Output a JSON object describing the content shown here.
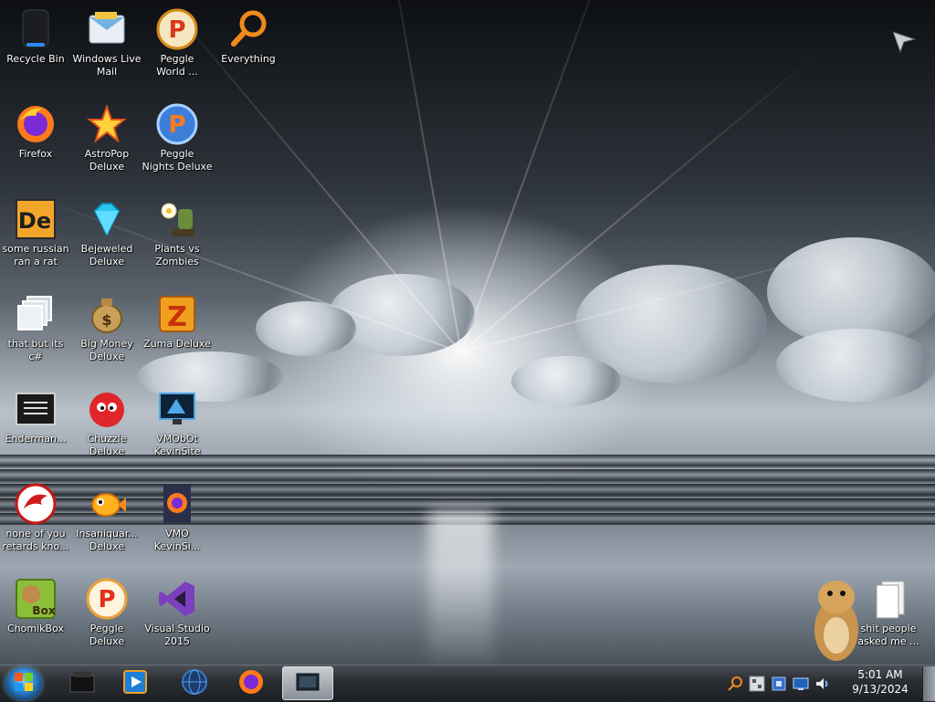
{
  "desktop": {
    "icons": [
      {
        "label": "Recycle Bin",
        "icon": "recycle-bin-icon"
      },
      {
        "label": "Windows Live\nMail",
        "icon": "mail-icon"
      },
      {
        "label": "Peggle\nWorld ...",
        "icon": "peggle-icon"
      },
      {
        "label": "Everything",
        "icon": "search-icon"
      },
      {
        "label": "Firefox",
        "icon": "firefox-icon"
      },
      {
        "label": "AstroPop\nDeluxe",
        "icon": "astropop-icon"
      },
      {
        "label": "Peggle\nNights Deluxe",
        "icon": "peggle-nights-icon"
      },
      {
        "label": "some russian\nran a rat",
        "icon": "de-app-icon"
      },
      {
        "label": "Bejeweled\nDeluxe",
        "icon": "gem-icon"
      },
      {
        "label": "Plants vs\nZombies",
        "icon": "plants-icon"
      },
      {
        "label": "that but its\nc#",
        "icon": "folder-stack-icon"
      },
      {
        "label": "Big Money\nDeluxe",
        "icon": "money-bag-icon"
      },
      {
        "label": "Zuma Deluxe",
        "icon": "zuma-icon"
      },
      {
        "label": "Enderman...",
        "icon": "terminal-icon"
      },
      {
        "label": "Chuzzle\nDeluxe",
        "icon": "chuzzle-icon"
      },
      {
        "label": "VMObOt\nKevinSite",
        "icon": "vm-monitor-icon"
      },
      {
        "label": "none of you\nretards kno...",
        "icon": "red-dragon-icon"
      },
      {
        "label": "Insaniquar...\nDeluxe",
        "icon": "goldfish-icon"
      },
      {
        "label": "VMO\nKevinSi...",
        "icon": "firefox-doc-icon"
      },
      {
        "label": "ChomikBox",
        "icon": "chomikbox-icon"
      },
      {
        "label": "Peggle\nDeluxe",
        "icon": "peggle-deluxe-icon"
      },
      {
        "label": "Visual Studio\n2015",
        "icon": "visual-studio-icon"
      },
      {
        "label": "shit people\nasked me ...",
        "icon": "folder-icon"
      }
    ]
  },
  "taskbar": {
    "start_icon": "windows-logo-icon",
    "pinned": [
      {
        "icon": "terminal-box-icon",
        "active": false
      },
      {
        "icon": "media-player-icon",
        "active": false
      },
      {
        "icon": "globe-icon",
        "active": false
      },
      {
        "icon": "firefox-icon",
        "active": false
      },
      {
        "icon": "window-app-icon",
        "active": true
      }
    ],
    "tray": [
      "search-icon",
      "network-icon",
      "security-icon",
      "display-icon",
      "volume-icon"
    ],
    "time": "5:01 AM",
    "date": "9/13/2024"
  },
  "colors": {
    "accent": "#2a7fc9",
    "peggle_orange": "#f08a1c",
    "vs_purple": "#7b3fbf"
  }
}
